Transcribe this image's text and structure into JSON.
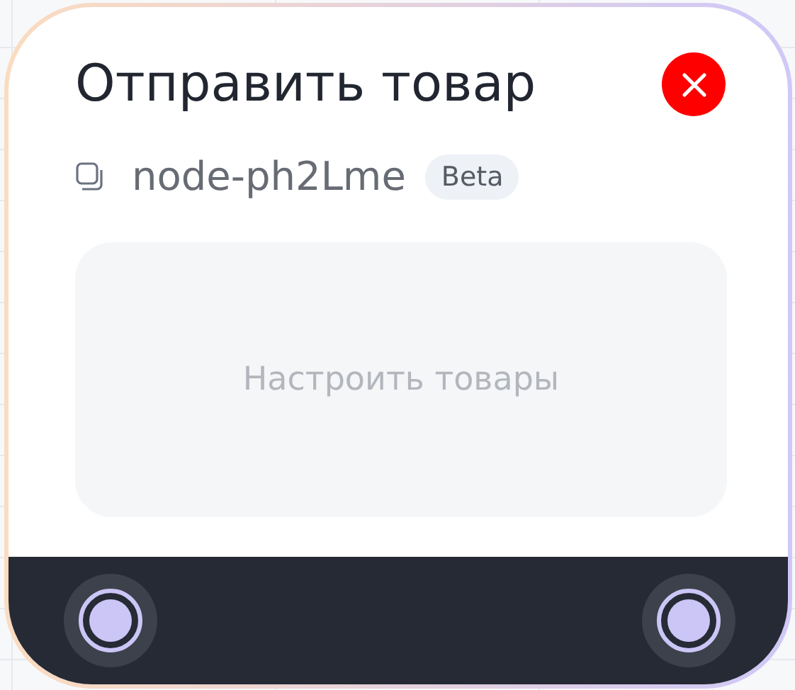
{
  "node": {
    "title": "Отправить товар",
    "id": "node-ph2Lme",
    "badge": "Beta",
    "action_label": "Настроить товары"
  }
}
